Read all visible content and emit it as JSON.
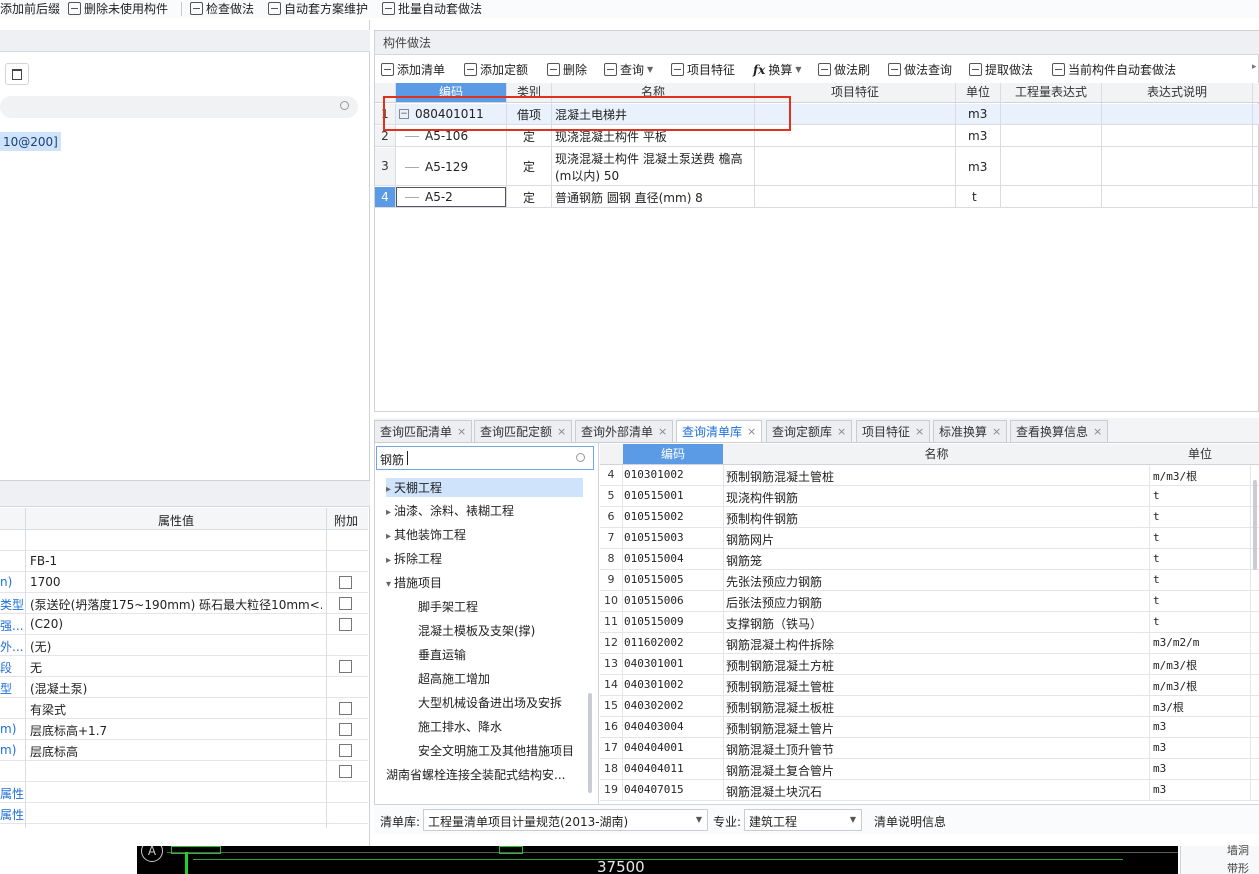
{
  "top_toolbar": {
    "items": [
      "添加前后缀",
      "删除未使用构件",
      "检查做法",
      "自动套方案维护",
      "批量自动套做法"
    ]
  },
  "left_search": {
    "placeholder": ""
  },
  "left_tree": {
    "selected_item": "10@200]"
  },
  "properties": {
    "header_value": "属性值",
    "header_attach": "附加",
    "rows": [
      {
        "name": "",
        "value": "",
        "checkbox": false
      },
      {
        "name": "",
        "value": "FB-1",
        "checkbox": false
      },
      {
        "name": "n)",
        "value": "1700",
        "checkbox": true
      },
      {
        "name": "类型",
        "value": "(泵送砼(坍落度175~190mm) 砾石最大粒径10mm<...",
        "checkbox": true
      },
      {
        "name": "强...",
        "value": "(C20)",
        "checkbox": true
      },
      {
        "name": "外...",
        "value": "(无)",
        "checkbox": false
      },
      {
        "name": "段",
        "value": "无",
        "checkbox": true
      },
      {
        "name": "型",
        "value": "(混凝土泵)",
        "checkbox": false
      },
      {
        "name": "",
        "value": "有梁式",
        "checkbox": true
      },
      {
        "name": "m)",
        "value": "层底标高+1.7",
        "checkbox": true
      },
      {
        "name": "m)",
        "value": "层底标高",
        "checkbox": true
      },
      {
        "name": "",
        "value": "",
        "checkbox": true
      },
      {
        "name": "属性",
        "value": "",
        "checkbox": false
      },
      {
        "name": "属性",
        "value": "",
        "checkbox": false
      }
    ]
  },
  "method_panel": {
    "title": "构件做法",
    "toolbar": [
      "添加清单",
      "添加定额",
      "删除",
      "查询",
      "项目特征",
      "换算",
      "做法刷",
      "做法查询",
      "提取做法",
      "当前构件自动套做法"
    ],
    "columns": [
      "编码",
      "类别",
      "名称",
      "项目特征",
      "单位",
      "工程量表达式",
      "表达式说明"
    ],
    "rows": [
      {
        "num": "1",
        "code": "080401011",
        "type": "借项",
        "name": "混凝土电梯井",
        "unit": "m3"
      },
      {
        "num": "2",
        "code": "A5-106",
        "type": "定",
        "name": "现浇混凝土构件 平板",
        "unit": "m3"
      },
      {
        "num": "3",
        "code": "A5-129",
        "type": "定",
        "name": "现浇混凝土构件 混凝土泵送费 檐高",
        "name2": "(m以内) 50",
        "unit": "m3"
      },
      {
        "num": "4",
        "code": "A5-2",
        "type": "定",
        "name": "普通钢筋 圆钢 直径(mm) 8",
        "unit": "t"
      }
    ]
  },
  "bottom_tabs": [
    "查询匹配清单",
    "查询匹配定额",
    "查询外部清单",
    "查询清单库",
    "查询定额库",
    "项目特征",
    "标准换算",
    "查看换算信息"
  ],
  "active_tab": "查询清单库",
  "search": {
    "value": "钢筋"
  },
  "category_tree": [
    {
      "label": "天棚工程",
      "level": 0,
      "arrow": "right",
      "selected": true
    },
    {
      "label": "油漆、涂料、裱糊工程",
      "level": 0,
      "arrow": "right"
    },
    {
      "label": "其他装饰工程",
      "level": 0,
      "arrow": "right"
    },
    {
      "label": "拆除工程",
      "level": 0,
      "arrow": "right"
    },
    {
      "label": "措施项目",
      "level": 0,
      "arrow": "down"
    },
    {
      "label": "脚手架工程",
      "level": 1
    },
    {
      "label": "混凝土模板及支架(撑)",
      "level": 1
    },
    {
      "label": "垂直运输",
      "level": 1
    },
    {
      "label": "超高施工增加",
      "level": 1
    },
    {
      "label": "大型机械设备进出场及安拆",
      "level": 1
    },
    {
      "label": "施工排水、降水",
      "level": 1
    },
    {
      "label": "安全文明施工及其他措施项目",
      "level": 1
    },
    {
      "label": "湖南省螺栓连接全装配式结构安...",
      "level": 0
    }
  ],
  "library_table": {
    "columns": [
      "编码",
      "名称",
      "单位"
    ],
    "rows": [
      {
        "num": "4",
        "code": "010301002",
        "name": "预制钢筋混凝土管桩",
        "unit": "m/m3/根"
      },
      {
        "num": "5",
        "code": "010515001",
        "name": "现浇构件钢筋",
        "unit": "t"
      },
      {
        "num": "6",
        "code": "010515002",
        "name": "预制构件钢筋",
        "unit": "t"
      },
      {
        "num": "7",
        "code": "010515003",
        "name": "钢筋网片",
        "unit": "t"
      },
      {
        "num": "8",
        "code": "010515004",
        "name": "钢筋笼",
        "unit": "t"
      },
      {
        "num": "9",
        "code": "010515005",
        "name": "先张法预应力钢筋",
        "unit": "t"
      },
      {
        "num": "10",
        "code": "010515006",
        "name": "后张法预应力钢筋",
        "unit": "t"
      },
      {
        "num": "11",
        "code": "010515009",
        "name": "支撑钢筋（铁马）",
        "unit": "t"
      },
      {
        "num": "12",
        "code": "011602002",
        "name": "钢筋混凝土构件拆除",
        "unit": "m3/m2/m"
      },
      {
        "num": "13",
        "code": "040301001",
        "name": "预制钢筋混凝土方桩",
        "unit": "m/m3/根"
      },
      {
        "num": "14",
        "code": "040301002",
        "name": "预制钢筋混凝土管桩",
        "unit": "m/m3/根"
      },
      {
        "num": "15",
        "code": "040302002",
        "name": "预制钢筋混凝土板桩",
        "unit": "m3/根"
      },
      {
        "num": "16",
        "code": "040403004",
        "name": "预制钢筋混凝土管片",
        "unit": "m3"
      },
      {
        "num": "17",
        "code": "040404001",
        "name": "钢筋混凝土顶升管节",
        "unit": "m3"
      },
      {
        "num": "18",
        "code": "040404011",
        "name": "钢筋混凝土复合管片",
        "unit": "m3"
      },
      {
        "num": "19",
        "code": "040407015",
        "name": "钢筋混凝土块沉石",
        "unit": "m3"
      }
    ]
  },
  "footer": {
    "lib_label": "清单库:",
    "lib_value": "工程量清单项目计量规范(2013-湖南)",
    "major_label": "专业:",
    "major_value": "建筑工程",
    "info_label": "清单说明信息"
  },
  "cad": {
    "axis_label": "A",
    "dimension": "37500"
  },
  "right_edge": {
    "items": [
      "墙洞",
      "带形窗"
    ]
  },
  "colors": {
    "highlight_red": "#e0301e",
    "select_blue": "#cfe3fb",
    "header_blue": "#5b9be6",
    "link_blue": "#1e6fd9"
  }
}
